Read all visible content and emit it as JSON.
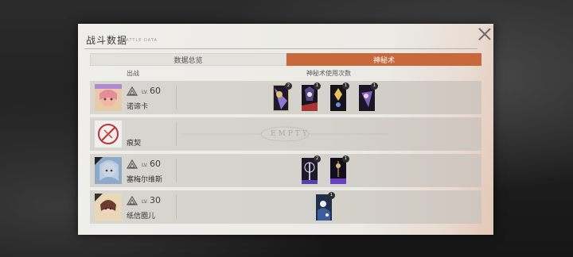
{
  "dialog": {
    "title": "战斗数据",
    "subtitle": "BATTLE DATA"
  },
  "tabs": [
    {
      "label": "数据总览",
      "active": false
    },
    {
      "label": "神秘术",
      "active": true
    }
  ],
  "columns": {
    "deploy": "出战",
    "usage": "神秘术使用次数"
  },
  "rows": [
    {
      "lv_label": "LV.",
      "level": "60",
      "name": "诺谛卡",
      "cards": [
        {
          "count": "2"
        },
        {
          "count": "1"
        },
        {
          "count": "1"
        },
        {
          "count": "1"
        }
      ]
    },
    {
      "lv_label": "",
      "level": "",
      "name": "痕契",
      "empty": "EMPTY",
      "cards": []
    },
    {
      "lv_label": "LV.",
      "level": "60",
      "name": "塞梅尔维斯",
      "cards": [
        {
          "count": "2"
        },
        {
          "count": "1"
        }
      ]
    },
    {
      "lv_label": "LV.",
      "level": "30",
      "name": "纸信圈儿",
      "cards": [
        {
          "count": "1"
        }
      ]
    }
  ],
  "colors": {
    "accent": "#c7693a",
    "panel": "#ebeae5",
    "row": "#d6d4ce"
  }
}
